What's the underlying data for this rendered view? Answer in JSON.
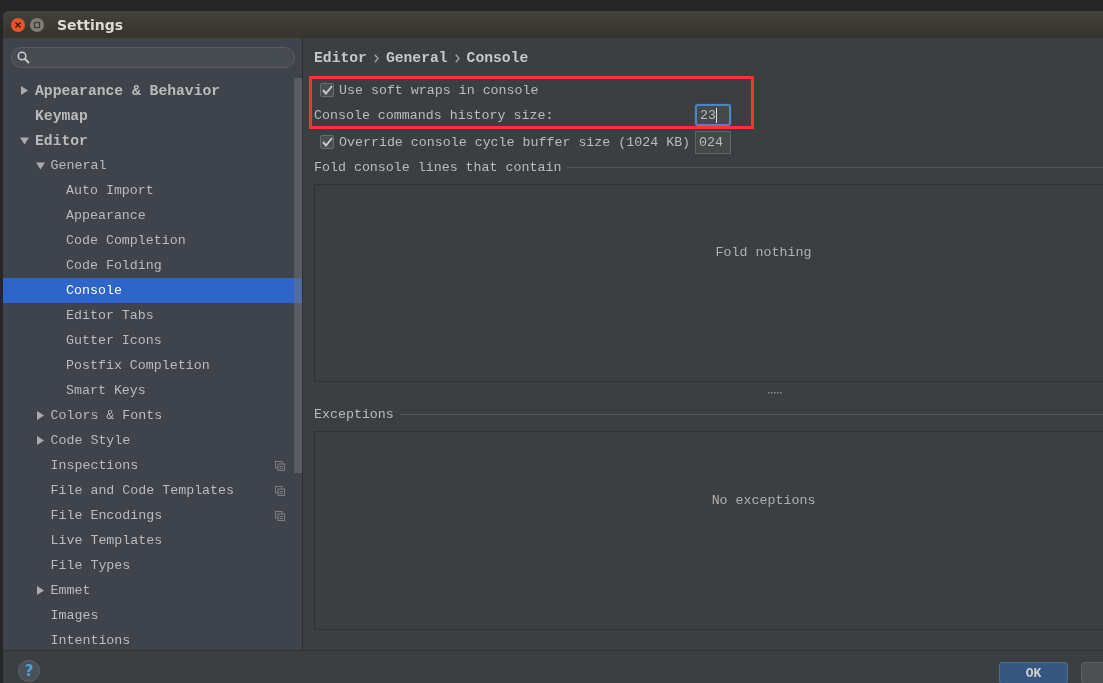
{
  "window": {
    "title": "Settings"
  },
  "tree": [
    {
      "label": "Appearance & Behavior",
      "kind": "group",
      "expanded": false,
      "selected": false
    },
    {
      "label": "Keymap",
      "kind": "page",
      "selected": false
    },
    {
      "label": "Editor",
      "kind": "group",
      "expanded": true,
      "selected": false,
      "children": [
        {
          "label": "General",
          "kind": "group",
          "expanded": true,
          "selected": false,
          "children": [
            {
              "label": "Auto Import",
              "kind": "page",
              "selected": false
            },
            {
              "label": "Appearance",
              "kind": "page",
              "selected": false
            },
            {
              "label": "Code Completion",
              "kind": "page",
              "selected": false
            },
            {
              "label": "Code Folding",
              "kind": "page",
              "selected": false
            },
            {
              "label": "Console",
              "kind": "page",
              "selected": true
            },
            {
              "label": "Editor Tabs",
              "kind": "page",
              "selected": false
            },
            {
              "label": "Gutter Icons",
              "kind": "page",
              "selected": false
            },
            {
              "label": "Postfix Completion",
              "kind": "page",
              "selected": false
            },
            {
              "label": "Smart Keys",
              "kind": "page",
              "selected": false
            }
          ]
        },
        {
          "label": "Colors & Fonts",
          "kind": "group",
          "expanded": false,
          "selected": false
        },
        {
          "label": "Code Style",
          "kind": "group",
          "expanded": false,
          "selected": false
        },
        {
          "label": "Inspections",
          "kind": "page",
          "selected": false,
          "trailing_icon": true
        },
        {
          "label": "File and Code Templates",
          "kind": "page",
          "selected": false,
          "trailing_icon": true
        },
        {
          "label": "File Encodings",
          "kind": "page",
          "selected": false,
          "trailing_icon": true
        },
        {
          "label": "Live Templates",
          "kind": "page",
          "selected": false
        },
        {
          "label": "File Types",
          "kind": "page",
          "selected": false
        },
        {
          "label": "Emmet",
          "kind": "group",
          "expanded": false,
          "selected": false
        },
        {
          "label": "Images",
          "kind": "page",
          "selected": false
        },
        {
          "label": "Intentions",
          "kind": "page",
          "selected": false
        }
      ]
    }
  ],
  "breadcrumb": [
    "Editor",
    "General",
    "Console"
  ],
  "options": [
    {
      "kind": "checkbox",
      "label": "Use soft wraps in console",
      "checked": true
    },
    {
      "kind": "field",
      "label": "Console commands history size:",
      "value": "23",
      "focused": true
    },
    {
      "kind": "checkbox_field",
      "label": "Override console cycle buffer size (1024 KB)",
      "checked": true,
      "value": "024",
      "focused": false
    }
  ],
  "fold_section": {
    "title": "Fold console lines that contain",
    "empty_text": "Fold nothing"
  },
  "exceptions_section": {
    "title": "Exceptions",
    "empty_text": "No exceptions"
  },
  "help_button": {
    "label": "?"
  },
  "buttons": [
    {
      "label": "OK",
      "primary": true
    },
    {
      "primary": false
    }
  ],
  "annotation": {
    "kind": "rectangle"
  }
}
